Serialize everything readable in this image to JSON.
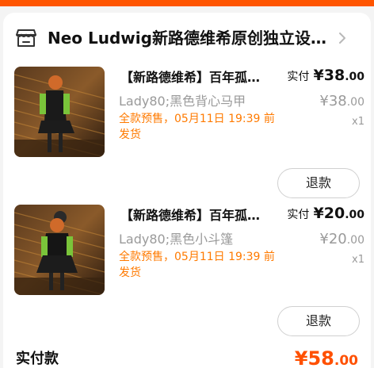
{
  "shop": {
    "name": "Neo Ludwig新路德维希原创独立设…",
    "icon": "store-icon",
    "chevron_icon": "chevron-right-icon"
  },
  "items": [
    {
      "title": "【新路德维希】百年孤…",
      "spec": "Lady80;黑色背心马甲",
      "presale": "全款预售，05月11日 19:39 前发货",
      "paid_label": "实付",
      "paid_int": "¥38",
      "paid_cents": ".00",
      "orig_int": "¥38",
      "orig_cents": ".00",
      "qty": "x1",
      "refund_label": "退款"
    },
    {
      "title": "【新路德维希】百年孤…",
      "spec": "Lady80;黑色小斗篷",
      "presale": "全款预售，05月11日 19:39 前发货",
      "paid_label": "实付",
      "paid_int": "¥20",
      "paid_cents": ".00",
      "orig_int": "¥20",
      "orig_cents": ".00",
      "qty": "x1",
      "refund_label": "退款"
    }
  ],
  "total": {
    "label": "实付款",
    "int": "¥58",
    "cents": ".00"
  },
  "colors": {
    "accent": "#ff5500",
    "presale": "#ff7a00",
    "muted": "#9a9a9a"
  }
}
